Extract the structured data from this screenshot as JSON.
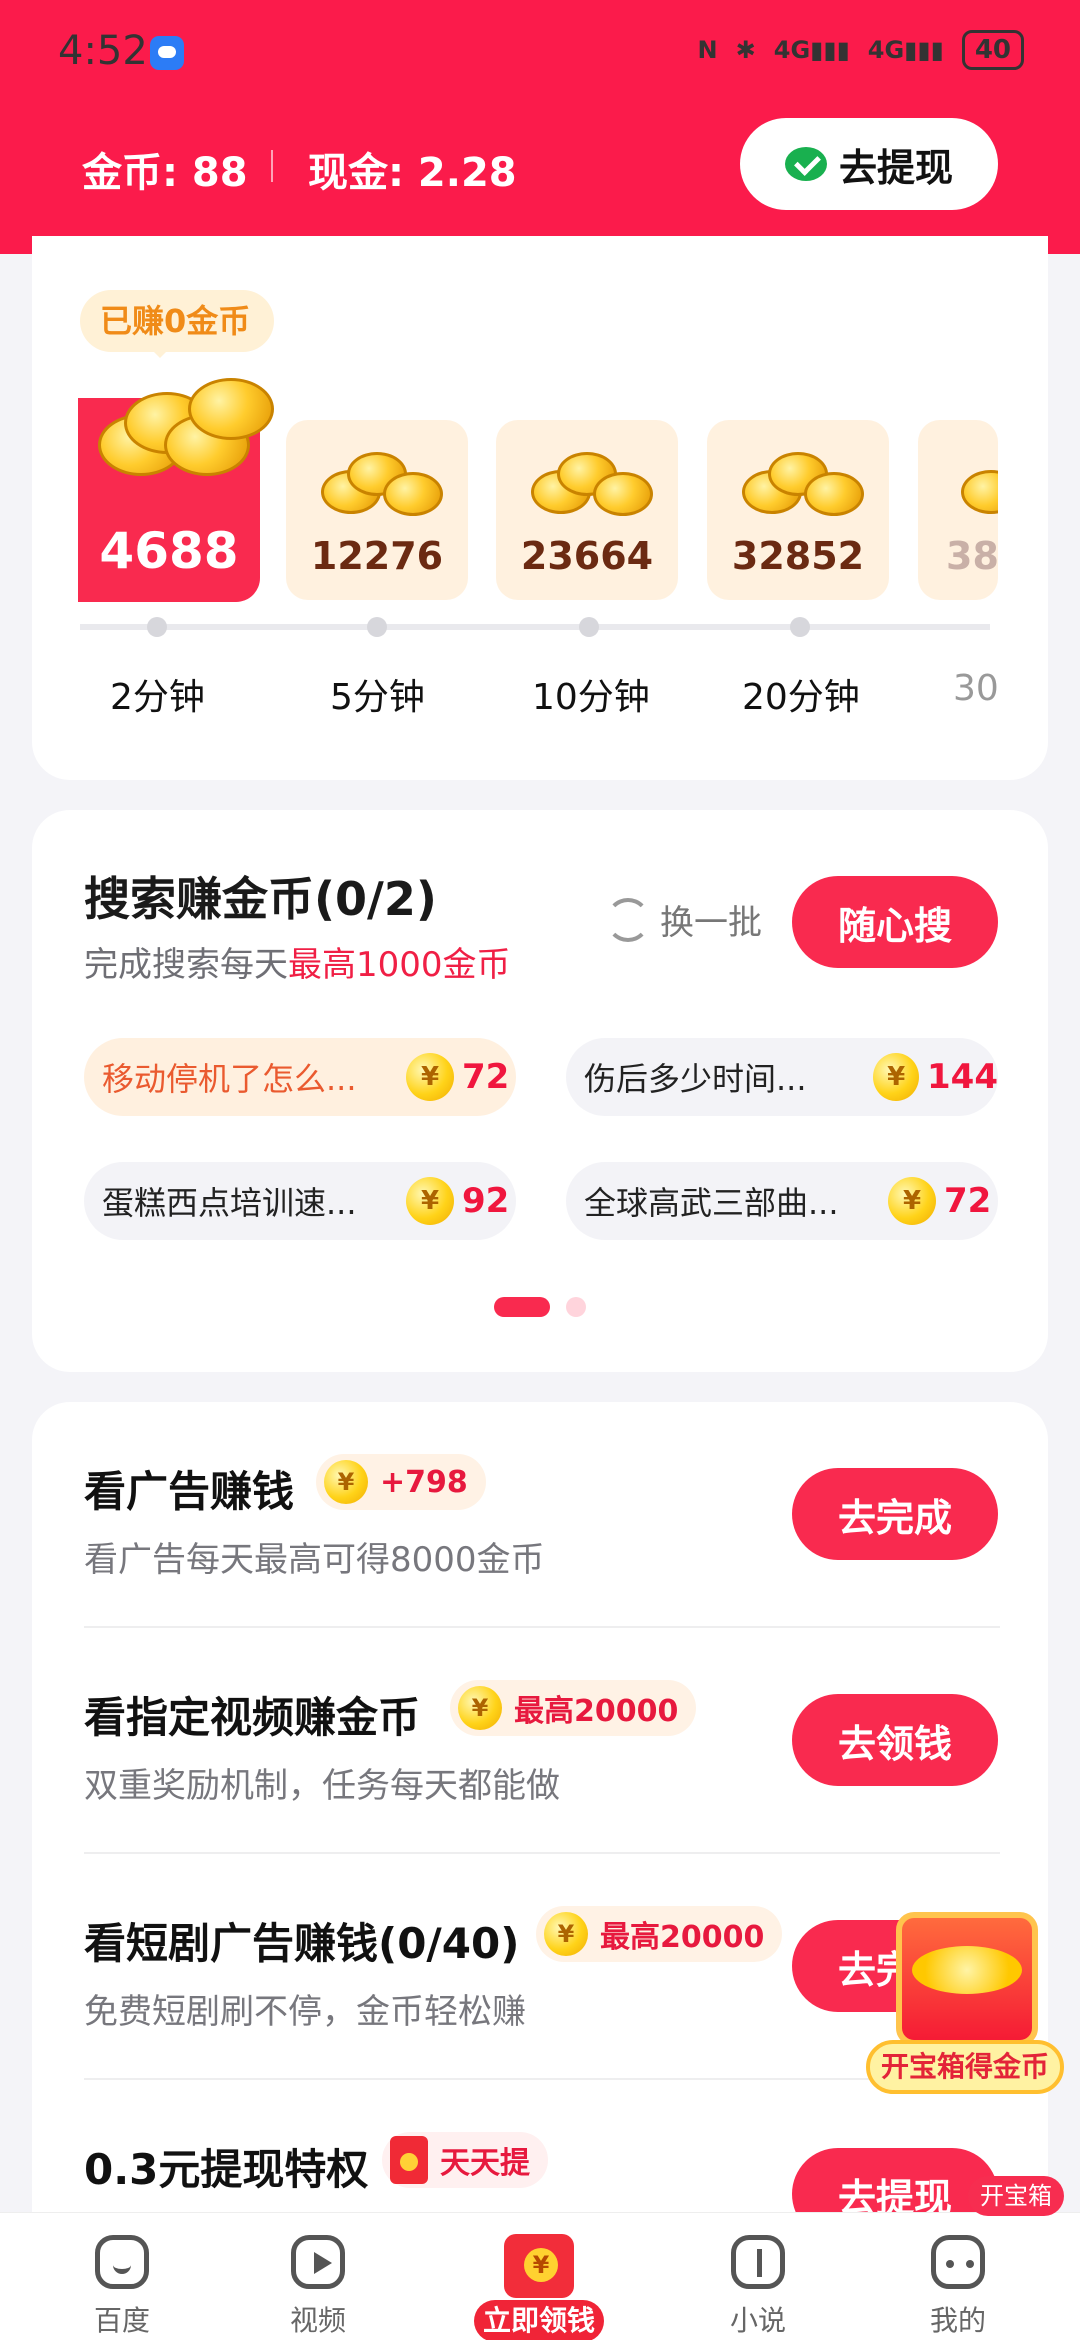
{
  "status": {
    "time": "4:52",
    "battery": "40"
  },
  "header": {
    "coins": "金币: 88",
    "cash": "现金: 2.28",
    "withdraw": "去提现"
  },
  "bubble": "已赚0金币",
  "rewards": [
    {
      "amount": "4688",
      "time": "2分钟"
    },
    {
      "amount": "12276",
      "time": "5分钟"
    },
    {
      "amount": "23664",
      "time": "10分钟"
    },
    {
      "amount": "32852",
      "time": "20分钟"
    },
    {
      "amount": "38",
      "time": "30"
    }
  ],
  "search": {
    "title": "搜索赚金币(0/2)",
    "subtitle_prefix": "完成搜索每天",
    "subtitle_highlight": "最高1000金币",
    "refresh": "换一批",
    "button": "随心搜",
    "items": [
      {
        "label": "移动停机了怎么...",
        "coins": "72"
      },
      {
        "label": "伤后多少时间...",
        "coins": "144"
      },
      {
        "label": "蛋糕西点培训速...",
        "coins": "92"
      },
      {
        "label": "全球高武三部曲...",
        "coins": "72"
      }
    ]
  },
  "tasks": [
    {
      "title": "看广告赚钱",
      "tag": "+798",
      "subtitle": "看广告每天最高可得8000金币",
      "button": "去完成"
    },
    {
      "title": "看指定视频赚金币",
      "tag": "最高20000",
      "subtitle": "双重奖励机制，任务每天都能做",
      "button": "去领钱"
    },
    {
      "title": "看短剧广告赚钱(0/40)",
      "tag": "最高20000",
      "subtitle": "免费短剧刷不停，金币轻松赚",
      "button": "去完成"
    },
    {
      "title": "0.3元提现特权",
      "tag": "天天提",
      "subtitle": "",
      "button": "去提现"
    }
  ],
  "treasure": "开宝箱得金币",
  "nav": {
    "baidu": "百度",
    "video": "视频",
    "center": "立即领钱",
    "novel": "小说",
    "mine": "我的",
    "badge": "开宝箱"
  },
  "colors": {
    "brand": "#fb1b4b",
    "button": "#f92a4f"
  }
}
